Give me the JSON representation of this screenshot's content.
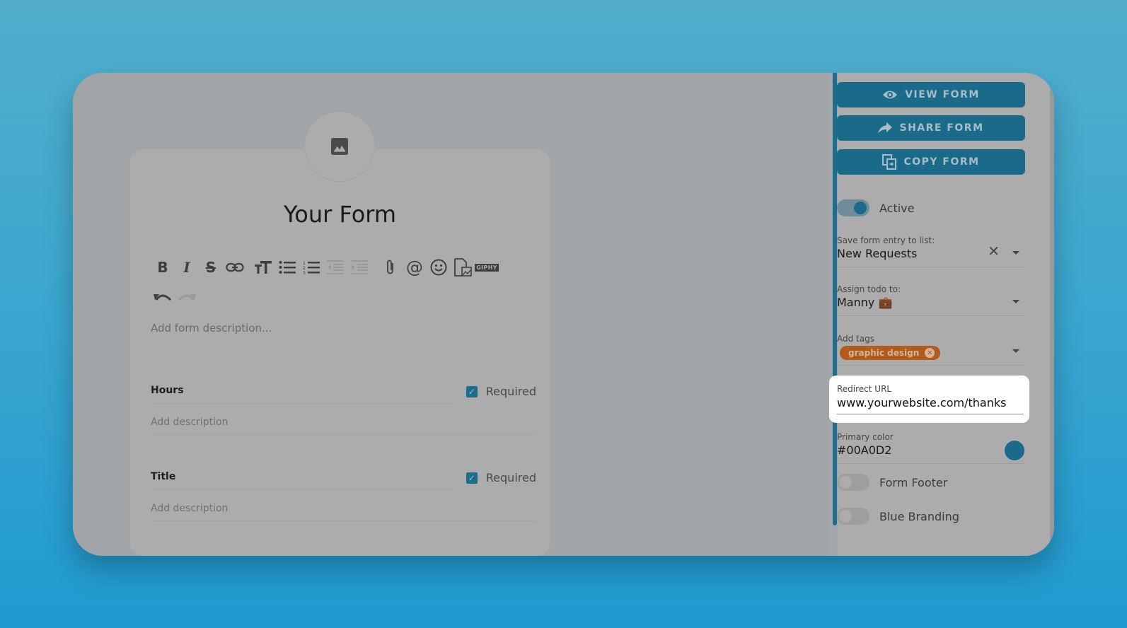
{
  "form": {
    "title": "Your Form",
    "description_placeholder": "Add form description...",
    "toolbar": {
      "row1": [
        {
          "icon": "bold-icon",
          "glyph": "B",
          "enabled": true
        },
        {
          "icon": "italic-icon",
          "glyph": "I",
          "enabled": true
        },
        {
          "icon": "strikethrough-icon",
          "glyph": "S",
          "enabled": true
        },
        {
          "icon": "link-icon",
          "glyph": "⊂⊃",
          "enabled": true
        },
        {
          "icon": "text-size-icon",
          "glyph": "тT",
          "enabled": true
        },
        {
          "icon": "bulleted-list-icon",
          "glyph": "☰",
          "enabled": true
        },
        {
          "icon": "numbered-list-icon",
          "glyph": "☷",
          "enabled": true
        },
        {
          "icon": "outdent-icon",
          "glyph": "⇤",
          "enabled": false
        },
        {
          "icon": "indent-icon",
          "glyph": "⇥",
          "enabled": false
        },
        {
          "icon": "attachment-icon",
          "glyph": "📎",
          "enabled": true
        },
        {
          "icon": "mention-icon",
          "glyph": "@",
          "enabled": true
        },
        {
          "icon": "emoji-icon",
          "glyph": "☺",
          "enabled": true
        },
        {
          "icon": "insert-image-icon",
          "glyph": "🗎",
          "enabled": true
        },
        {
          "icon": "giphy-icon",
          "glyph": "GIPHY",
          "enabled": true
        }
      ],
      "row2": [
        {
          "icon": "undo-icon",
          "glyph": "↶",
          "enabled": true
        },
        {
          "icon": "redo-icon",
          "glyph": "↷",
          "enabled": false
        }
      ]
    },
    "fields": [
      {
        "name": "Hours",
        "required_label": "Required",
        "required": true,
        "description_placeholder": "Add description"
      },
      {
        "name": "Title",
        "required_label": "Required",
        "required": true,
        "description_placeholder": "Add description"
      }
    ]
  },
  "panel": {
    "buttons": {
      "view": "VIEW FORM",
      "share": "SHARE FORM",
      "copy": "COPY FORM"
    },
    "active_toggle": {
      "label": "Active",
      "on": true
    },
    "save_to_list": {
      "label": "Save form entry to list:",
      "value": "New Requests"
    },
    "assign_todo": {
      "label": "Assign todo to:",
      "value": "Manny 💼"
    },
    "tags": {
      "label": "Add tags",
      "items": [
        "graphic design"
      ]
    },
    "redirect_url": {
      "label": "Redirect URL",
      "value": "www.yourwebsite.com/thanks"
    },
    "primary_color": {
      "label": "Primary color",
      "value": "#00A0D2"
    },
    "form_footer_toggle": {
      "label": "Form Footer",
      "on": false
    },
    "blue_branding_toggle": {
      "label": "Blue Branding",
      "on": false
    }
  },
  "colors": {
    "accent": "#1b6a8a",
    "tag": "#b15c1c",
    "primary": "#00A0D2"
  }
}
